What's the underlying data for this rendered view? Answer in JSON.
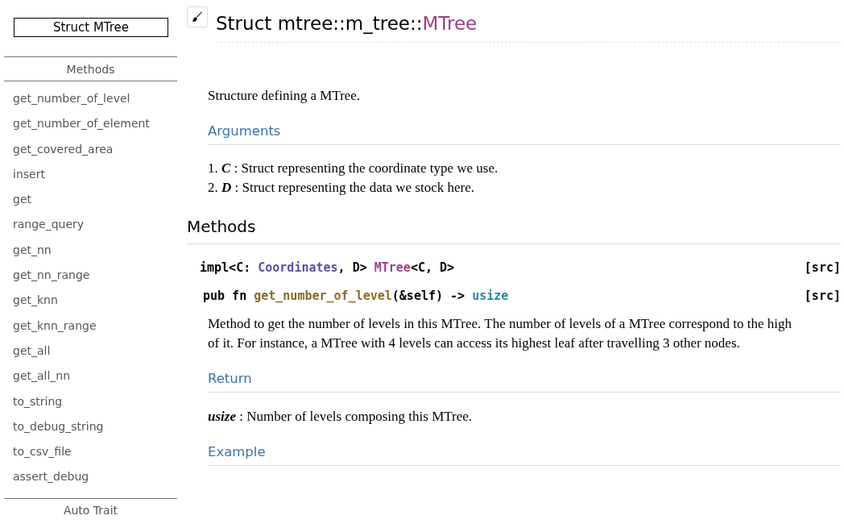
{
  "sidebar": {
    "title": "Struct MTree",
    "section": "Methods",
    "items": [
      "get_number_of_level",
      "get_number_of_element",
      "get_covered_area",
      "insert",
      "get",
      "range_query",
      "get_nn",
      "get_nn_range",
      "get_knn",
      "get_knn_range",
      "get_all",
      "get_all_nn",
      "to_string",
      "to_debug_string",
      "to_csv_file",
      "assert_debug"
    ],
    "next_section": "Auto Trait"
  },
  "heading": {
    "prefix": "Struct mtree::m_tree::",
    "name": "MTree"
  },
  "description": "Structure defining a MTree.",
  "arguments": {
    "title": "Arguments",
    "items": [
      {
        "number": "1.",
        "name": "C",
        "text": " : Struct representing the coordinate type we use."
      },
      {
        "number": "2.",
        "name": "D",
        "text": " : Struct representing the data we stock here."
      }
    ]
  },
  "methods": {
    "title": "Methods",
    "impl": {
      "tokens": [
        {
          "kind": "kw",
          "text": "impl<C: "
        },
        {
          "kind": "trait",
          "text": "Coordinates"
        },
        {
          "kind": "kw",
          "text": ", D> "
        },
        {
          "kind": "struct",
          "text": "MTree"
        },
        {
          "kind": "kw",
          "text": "<C, D>"
        }
      ],
      "src": "[src]"
    },
    "fn": {
      "tokens": [
        {
          "kind": "kw",
          "text": "pub fn "
        },
        {
          "kind": "fn",
          "text": "get_number_of_level"
        },
        {
          "kind": "kw",
          "text": "(&self) -> "
        },
        {
          "kind": "prim",
          "text": "usize"
        }
      ],
      "src": "[src]"
    },
    "doc": "Method to get the number of levels in this MTree. The number of levels of a MTree correspond to the high of it. For instance, a MTree with 4 levels can access its highest leaf after travelling 3 other nodes.",
    "return_title": "Return",
    "return": {
      "name": "usize",
      "text": " : Number of levels composing this MTree."
    },
    "example_title": "Example"
  }
}
